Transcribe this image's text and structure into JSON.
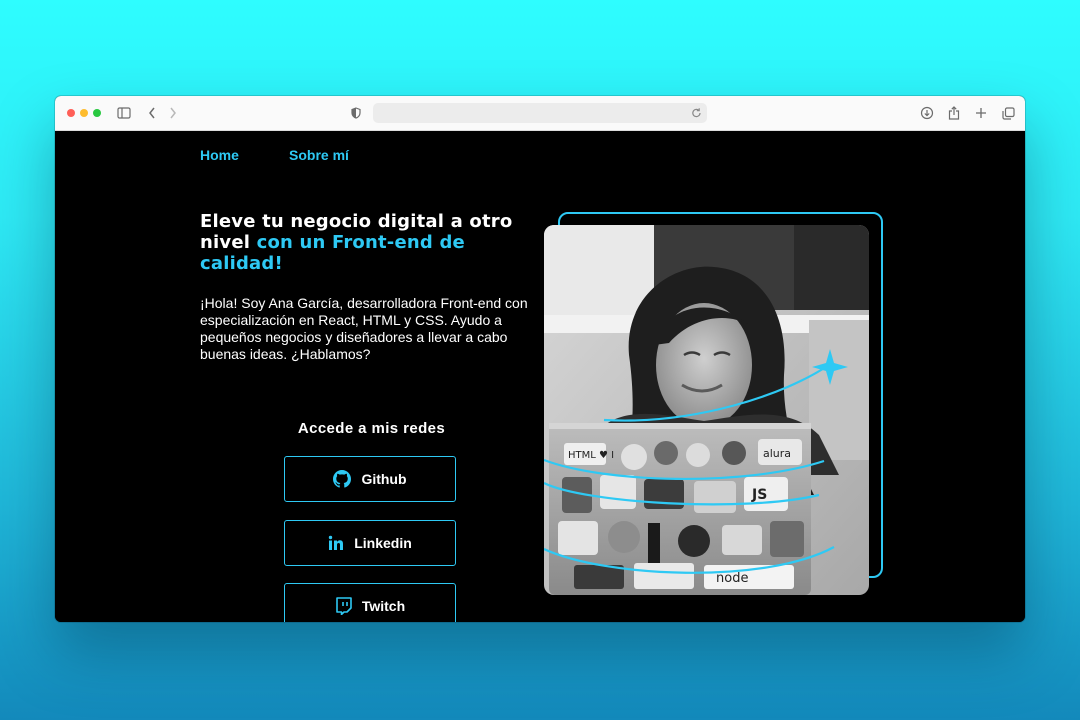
{
  "browser": {
    "icons": [
      "sidebar-icon",
      "back-icon",
      "forward-icon",
      "shield-icon",
      "reload-icon",
      "download-icon",
      "share-icon",
      "new-tab-icon",
      "tabs-overview-icon"
    ]
  },
  "nav": {
    "home": "Home",
    "about": "Sobre mí"
  },
  "hero": {
    "headline_white": "Eleve tu negocio digital a otro nivel",
    "headline_accent": "con un Front-end de calidad!",
    "intro": "¡Hola! Soy Ana García, desarrolladora Front-end con especialización en React, HTML y CSS. Ayudo a pequeños negocios y diseñadores a llevar a cabo buenas ideas. ¿Hablamos?"
  },
  "social": {
    "title": "Accede a mis redes",
    "buttons": [
      {
        "label": "Github",
        "icon": "github-icon"
      },
      {
        "label": "Linkedin",
        "icon": "linkedin-icon"
      },
      {
        "label": "Twitch",
        "icon": "twitch-icon"
      }
    ]
  },
  "colors": {
    "accent": "#2ec9f4",
    "background": "#000000",
    "text": "#ffffff"
  },
  "photo": {
    "laptop_stickers": [
      "HTML ♥ I",
      "alura",
      "JS",
      "node"
    ]
  }
}
